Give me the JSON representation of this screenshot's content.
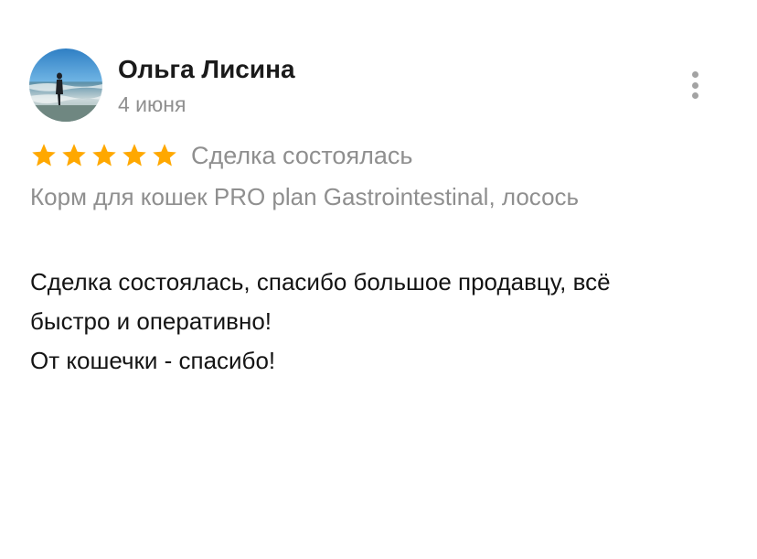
{
  "review": {
    "author_name": "Ольга Лисина",
    "date": "4 июня",
    "rating": 5,
    "rating_max": 5,
    "deal_status": "Сделка состоялась",
    "item_title": "Корм для кошек PRO plan Gastrointestinal, лосось",
    "text_lines": [
      "Сделка состоялась, спасибо большое продавцу, всё",
      "быстро и оперативно!",
      "От кошечки - спасибо!"
    ]
  },
  "icons": {
    "more": "more-vertical-icon",
    "star": "star-icon"
  },
  "colors": {
    "star": "#FFA800",
    "muted_text": "#8F8F8F",
    "primary_text": "#141414"
  }
}
